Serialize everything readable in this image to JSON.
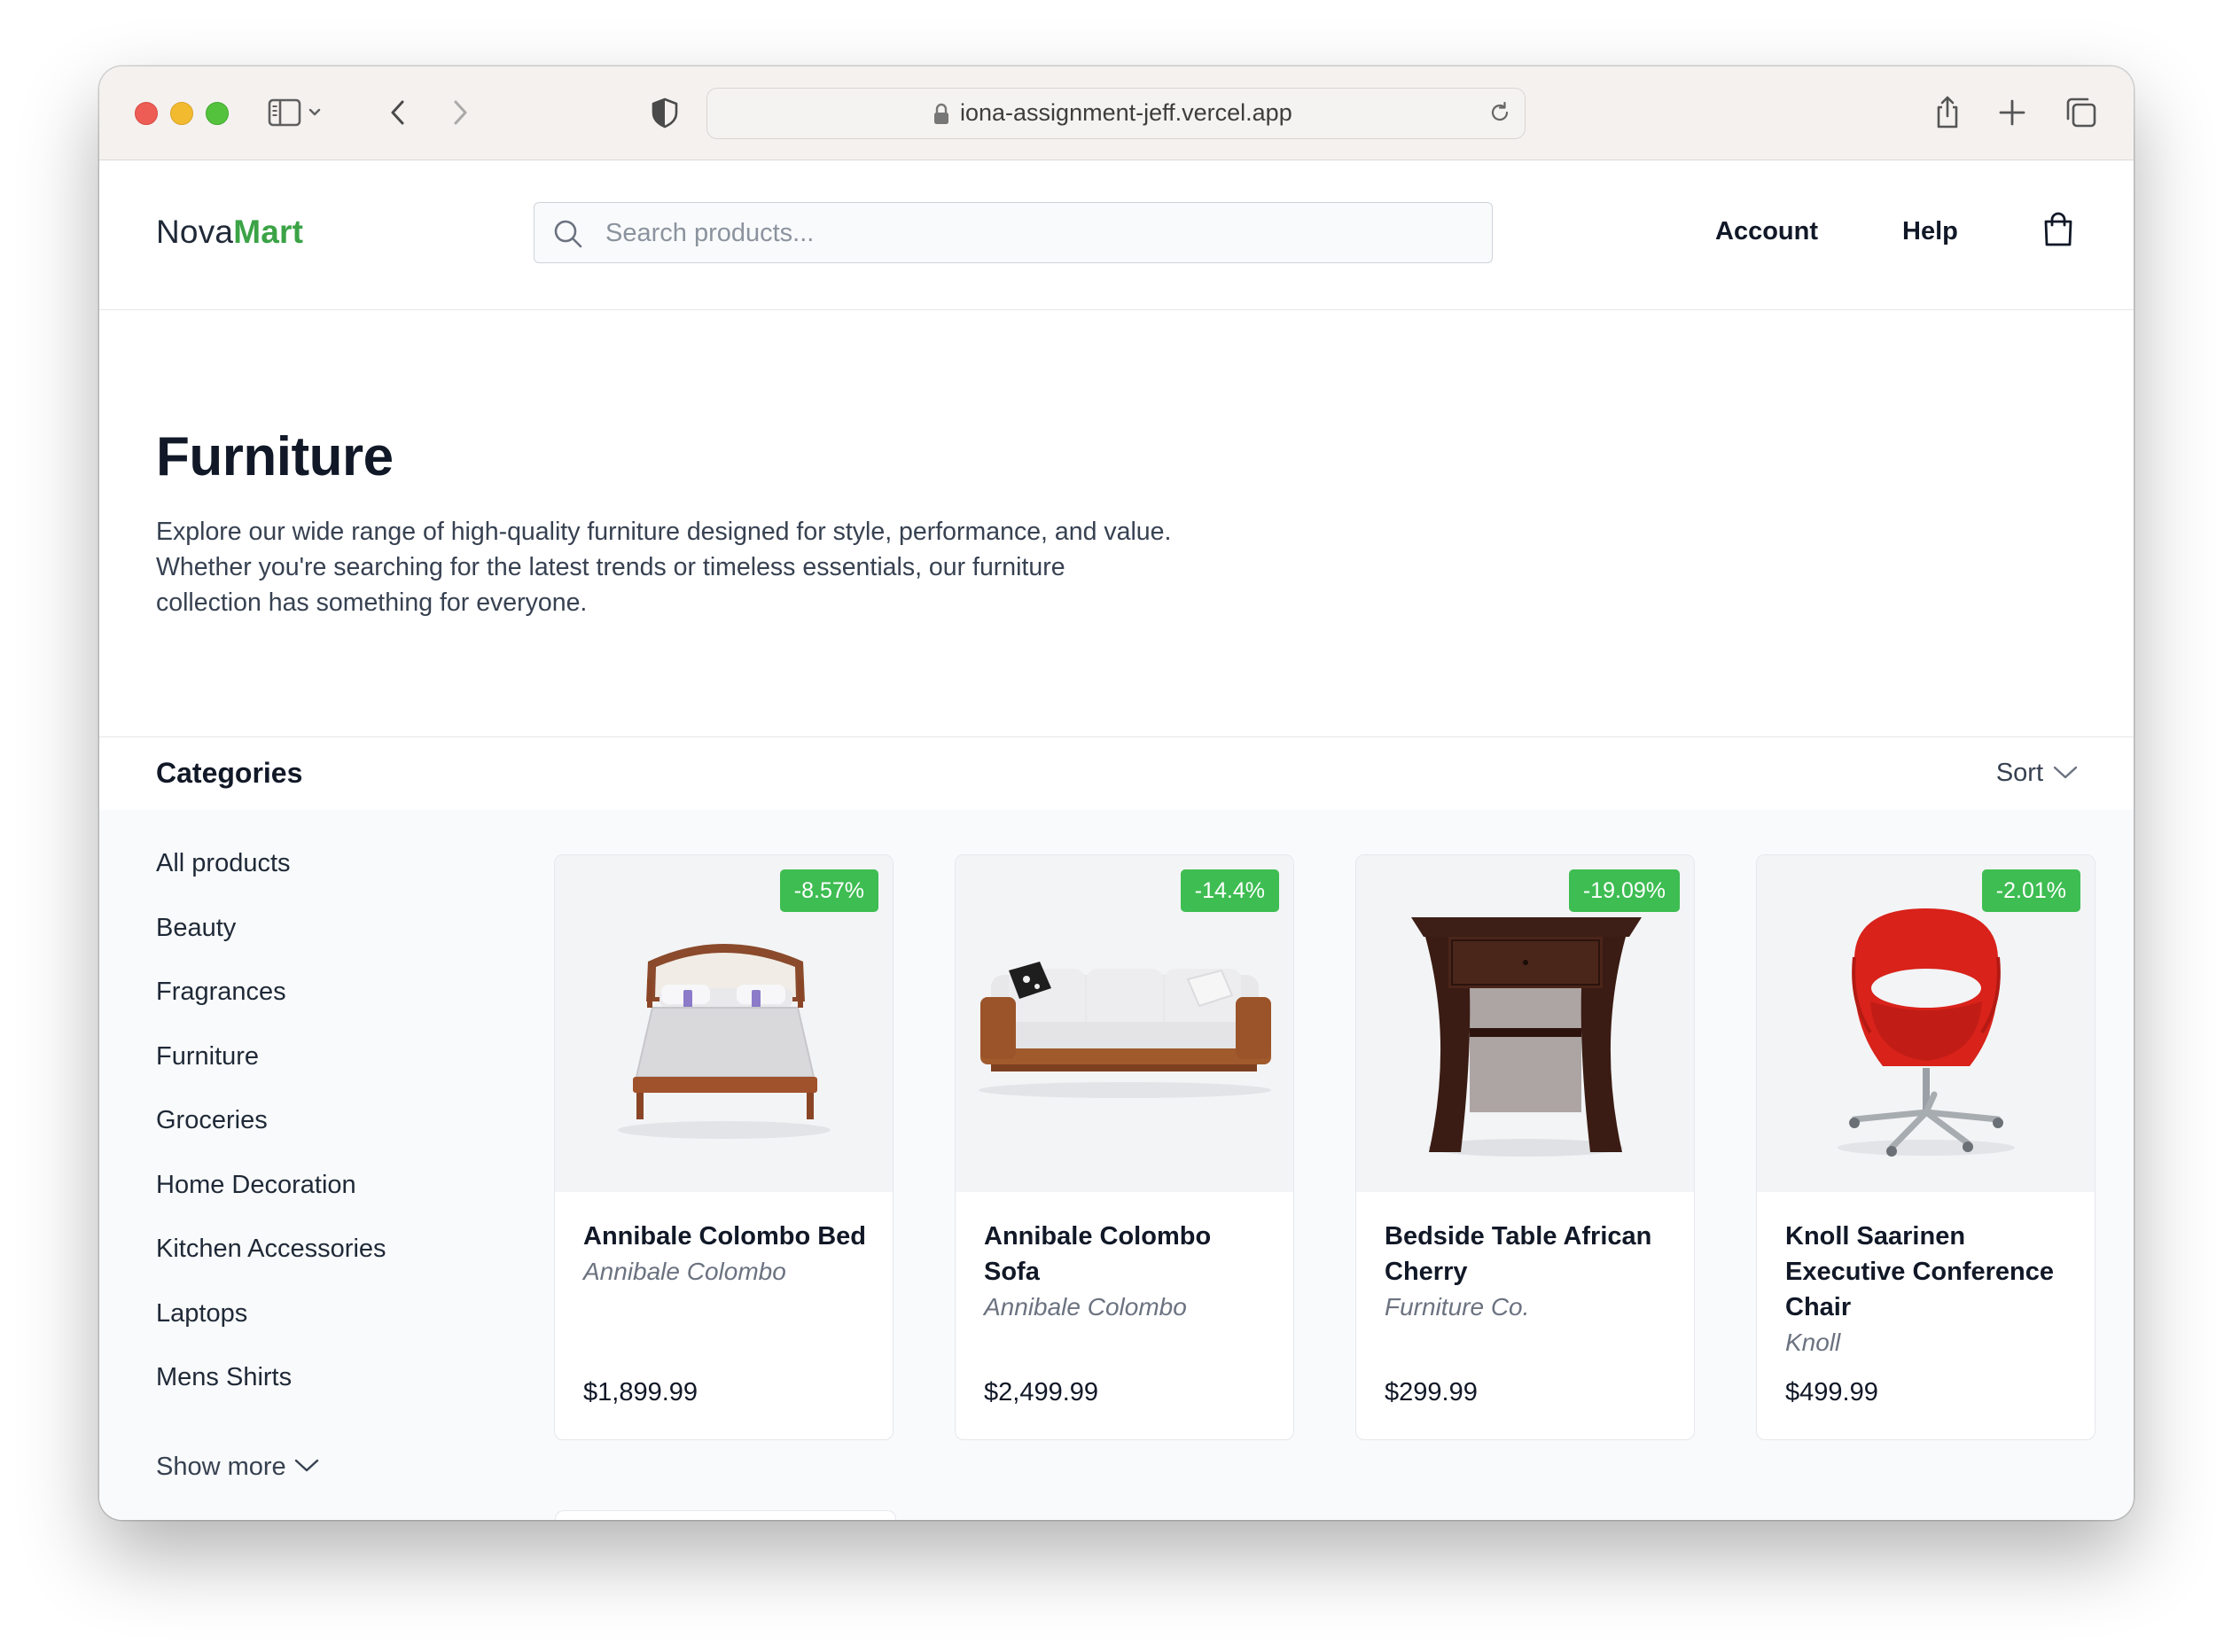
{
  "browser": {
    "url": "iona-assignment-jeff.vercel.app"
  },
  "header": {
    "logo_part1": "Nova",
    "logo_part2": "Mart",
    "search_placeholder": "Search products...",
    "nav": [
      "Account",
      "Help"
    ]
  },
  "hero": {
    "title": "Furniture",
    "description": "Explore our wide range of high-quality furniture designed for style, performance, and value. Whether you're searching for the latest trends or timeless essentials, our furniture collection has something for everyone."
  },
  "categories": {
    "title": "Categories",
    "sort_label": "Sort",
    "items": [
      "All products",
      "Beauty",
      "Fragrances",
      "Furniture",
      "Groceries",
      "Home Decoration",
      "Kitchen Accessories",
      "Laptops",
      "Mens Shirts"
    ],
    "show_more": "Show more"
  },
  "products": [
    {
      "name": "Annibale Colombo Bed",
      "brand": "Annibale Colombo",
      "price": "$1,899.99",
      "discount": "-8.57%",
      "image_icon": "bed-image"
    },
    {
      "name": "Annibale Colombo Sofa",
      "brand": "Annibale Colombo",
      "price": "$2,499.99",
      "discount": "-14.4%",
      "image_icon": "sofa-image"
    },
    {
      "name": "Bedside Table African Cherry",
      "brand": "Furniture Co.",
      "price": "$299.99",
      "discount": "-19.09%",
      "image_icon": "bedside-table-image"
    },
    {
      "name": "Knoll Saarinen Executive Conference Chair",
      "brand": "Knoll",
      "price": "$499.99",
      "discount": "-2.01%",
      "image_icon": "chair-image"
    }
  ],
  "colors": {
    "brand_green": "#3ba346",
    "badge_green": "#3ebd52"
  }
}
